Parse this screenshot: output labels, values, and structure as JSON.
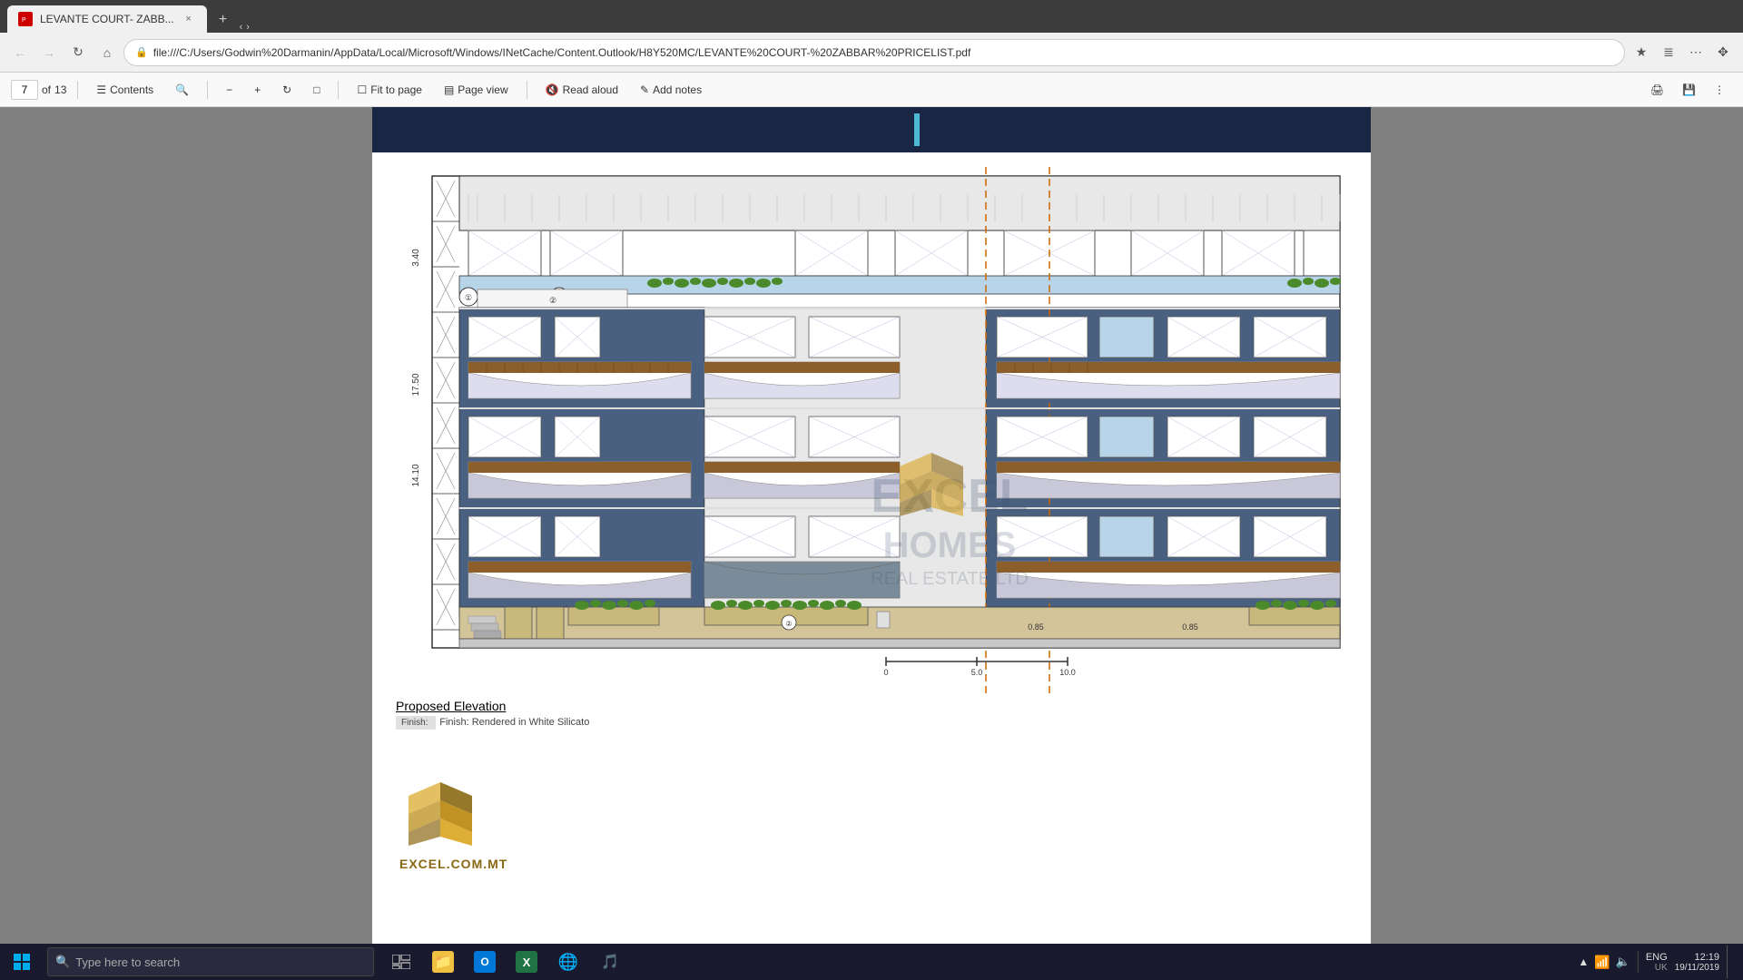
{
  "browser": {
    "tab": {
      "title": "LEVANTE COURT- ZABB...",
      "favicon": "PDF"
    },
    "address": "file:///C:/Users/Godwin%20Darmanin/AppData/Local/Microsoft/Windows/INetCache/Content.Outlook/H8Y520MC/LEVANTE%20COURT-%20ZABBAR%20PRICELIST.pdf",
    "nav": {
      "back": "‹",
      "forward": "›",
      "refresh": "↻",
      "home": "⌂"
    }
  },
  "toolbar": {
    "page_current": "7",
    "page_total": "13",
    "contents_label": "Contents",
    "zoom_out": "−",
    "zoom_in": "+",
    "fit_label": "Fit to page",
    "page_view_label": "Page view",
    "read_aloud_label": "Read aloud",
    "add_notes_label": "Add notes"
  },
  "pdf": {
    "drawing_title": "Proposed Elevation",
    "drawing_subtitle": "Finish: Rendered in White Silicato",
    "watermark": "EXCEL HOMES REAL ESTATE LTD"
  },
  "taskbar": {
    "search_placeholder": "Type here to search",
    "apps": [
      "⊞",
      "📁",
      "✉",
      "X",
      "🌐",
      "🎵"
    ],
    "clock_time": "12:19",
    "clock_date": "19/11/2019",
    "language": "ENG",
    "region": "UK"
  }
}
